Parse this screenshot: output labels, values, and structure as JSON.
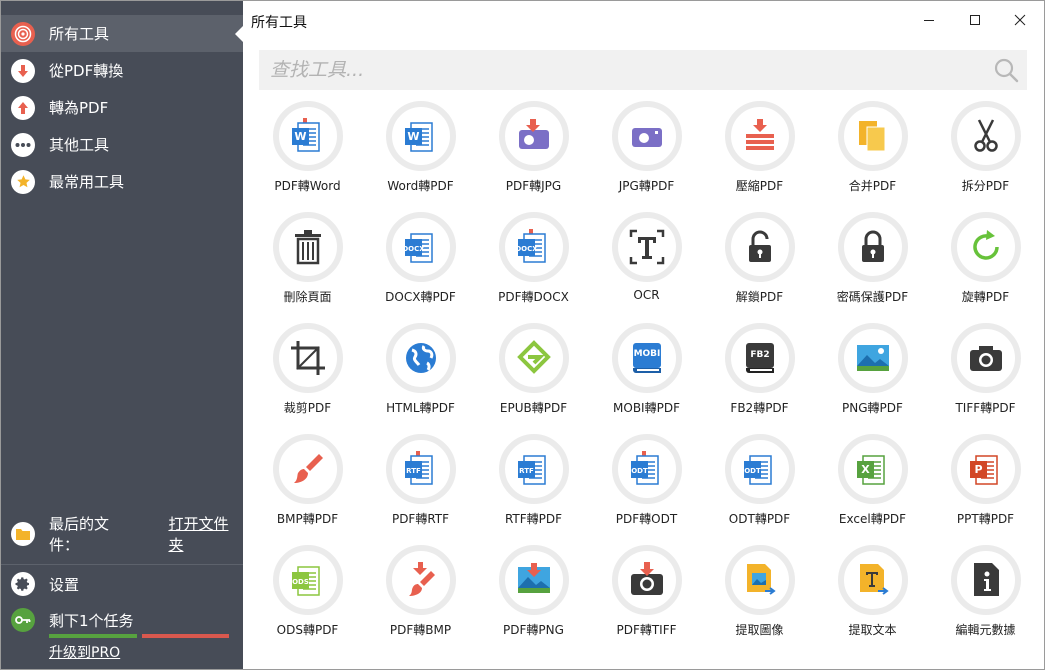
{
  "sidebar": {
    "items": [
      {
        "label": "所有工具"
      },
      {
        "label": "從PDF轉換"
      },
      {
        "label": "轉為PDF"
      },
      {
        "label": "其他工具"
      },
      {
        "label": "最常用工具"
      }
    ],
    "recent_label": "最后的文件：",
    "open_folder": "打开文件夹",
    "settings": "设置",
    "tasks_left": "剩下1个任务",
    "tasks_progress": {
      "used": 1,
      "total": 2
    },
    "upgrade": "升级到PRO"
  },
  "window": {
    "title": "所有工具"
  },
  "search": {
    "placeholder": "查找工具..."
  },
  "colors": {
    "sidebar_bg": "#474c57",
    "accent_red": "#e8604f",
    "accent_green": "#57a23f",
    "word_blue": "#2b7cd3",
    "purple": "#7b6fc6"
  },
  "tools": [
    {
      "label": "PDF轉Word",
      "icon": "pdf-to-word-icon"
    },
    {
      "label": "Word轉PDF",
      "icon": "word-to-pdf-icon"
    },
    {
      "label": "PDF轉JPG",
      "icon": "pdf-to-jpg-icon"
    },
    {
      "label": "JPG轉PDF",
      "icon": "jpg-to-pdf-icon"
    },
    {
      "label": "壓縮PDF",
      "icon": "compress-pdf-icon"
    },
    {
      "label": "合并PDF",
      "icon": "merge-pdf-icon"
    },
    {
      "label": "拆分PDF",
      "icon": "split-pdf-icon"
    },
    {
      "label": "刪除頁面",
      "icon": "delete-pages-icon"
    },
    {
      "label": "DOCX轉PDF",
      "icon": "docx-to-pdf-icon"
    },
    {
      "label": "PDF轉DOCX",
      "icon": "pdf-to-docx-icon"
    },
    {
      "label": "OCR",
      "icon": "ocr-icon"
    },
    {
      "label": "解鎖PDF",
      "icon": "unlock-pdf-icon"
    },
    {
      "label": "密碼保護PDF",
      "icon": "protect-pdf-icon"
    },
    {
      "label": "旋轉PDF",
      "icon": "rotate-pdf-icon"
    },
    {
      "label": "裁剪PDF",
      "icon": "crop-pdf-icon"
    },
    {
      "label": "HTML轉PDF",
      "icon": "html-to-pdf-icon"
    },
    {
      "label": "EPUB轉PDF",
      "icon": "epub-to-pdf-icon"
    },
    {
      "label": "MOBI轉PDF",
      "icon": "mobi-to-pdf-icon"
    },
    {
      "label": "FB2轉PDF",
      "icon": "fb2-to-pdf-icon"
    },
    {
      "label": "PNG轉PDF",
      "icon": "png-to-pdf-icon"
    },
    {
      "label": "TIFF轉PDF",
      "icon": "tiff-to-pdf-icon"
    },
    {
      "label": "BMP轉PDF",
      "icon": "bmp-to-pdf-icon"
    },
    {
      "label": "PDF轉RTF",
      "icon": "pdf-to-rtf-icon"
    },
    {
      "label": "RTF轉PDF",
      "icon": "rtf-to-pdf-icon"
    },
    {
      "label": "PDF轉ODT",
      "icon": "pdf-to-odt-icon"
    },
    {
      "label": "ODT轉PDF",
      "icon": "odt-to-pdf-icon"
    },
    {
      "label": "Excel轉PDF",
      "icon": "excel-to-pdf-icon"
    },
    {
      "label": "PPT轉PDF",
      "icon": "ppt-to-pdf-icon"
    },
    {
      "label": "ODS轉PDF",
      "icon": "ods-to-pdf-icon"
    },
    {
      "label": "PDF轉BMP",
      "icon": "pdf-to-bmp-icon"
    },
    {
      "label": "PDF轉PNG",
      "icon": "pdf-to-png-icon"
    },
    {
      "label": "PDF轉TIFF",
      "icon": "pdf-to-tiff-icon"
    },
    {
      "label": "提取圖像",
      "icon": "extract-images-icon"
    },
    {
      "label": "提取文本",
      "icon": "extract-text-icon"
    },
    {
      "label": "編輯元數據",
      "icon": "edit-metadata-icon"
    }
  ]
}
